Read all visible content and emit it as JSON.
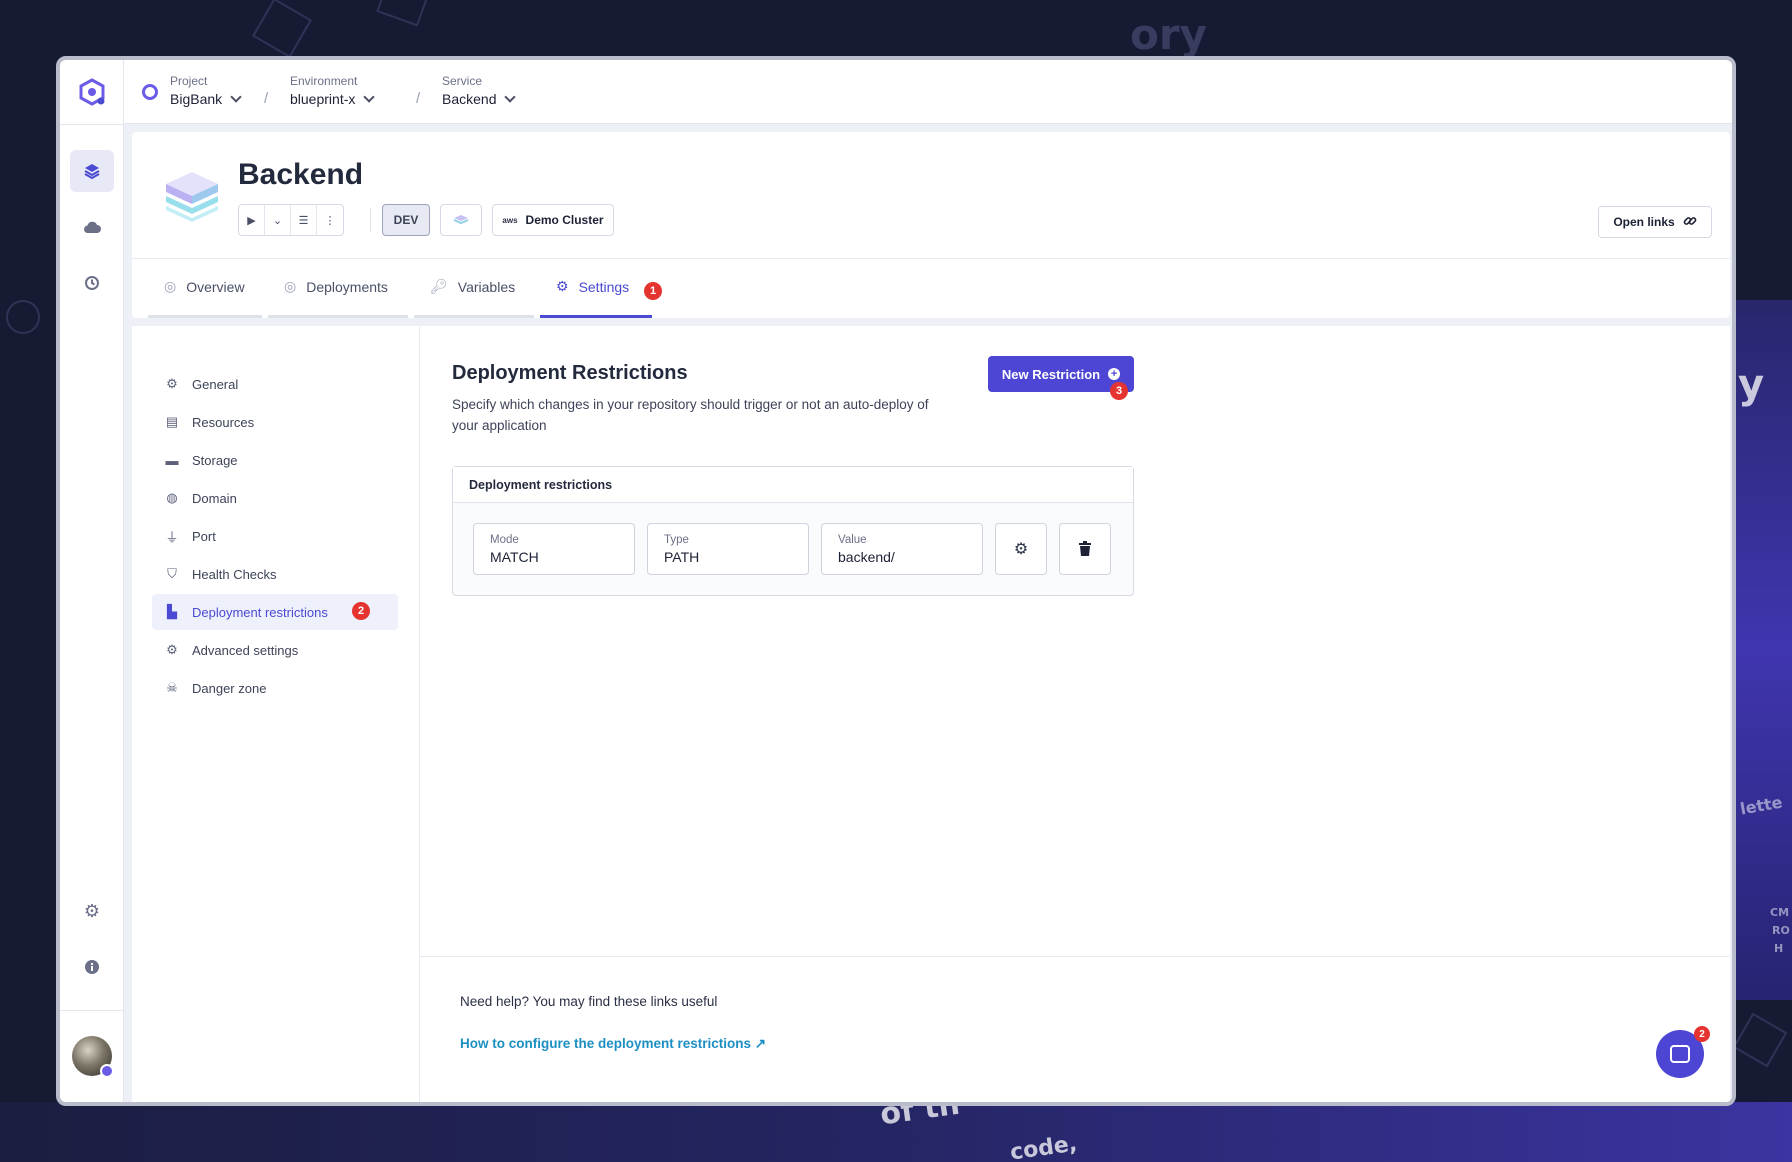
{
  "breadcrumbs": [
    {
      "label": "Project",
      "value": "BigBank"
    },
    {
      "label": "Environment",
      "value": "blueprint-x"
    },
    {
      "label": "Service",
      "value": "Backend"
    }
  ],
  "separator": "/",
  "service": {
    "title": "Backend",
    "env_tag": "DEV",
    "cluster_provider": "aws",
    "cluster": "Demo Cluster",
    "open_links": "Open links"
  },
  "tabs": [
    {
      "label": "Overview",
      "icon": "circle-icon"
    },
    {
      "label": "Deployments",
      "icon": "circle-icon"
    },
    {
      "label": "Variables",
      "icon": "key-icon"
    },
    {
      "label": "Settings",
      "icon": "gear-icon",
      "active": true
    }
  ],
  "badges": {
    "tab": "1",
    "subnav": "2",
    "button": "3",
    "chat": "2"
  },
  "settings_nav": [
    {
      "label": "General",
      "icon": "gear-icon"
    },
    {
      "label": "Resources",
      "icon": "resources-icon"
    },
    {
      "label": "Storage",
      "icon": "storage-icon"
    },
    {
      "label": "Domain",
      "icon": "globe-icon"
    },
    {
      "label": "Port",
      "icon": "plug-icon"
    },
    {
      "label": "Health Checks",
      "icon": "shield-icon"
    },
    {
      "label": "Deployment restrictions",
      "icon": "restriction-icon",
      "active": true
    },
    {
      "label": "Advanced settings",
      "icon": "gears-icon"
    },
    {
      "label": "Danger zone",
      "icon": "skull-icon"
    }
  ],
  "content": {
    "title": "Deployment Restrictions",
    "description": "Specify which changes in your repository should trigger or not an auto-deploy of your application",
    "new_button": "New Restriction",
    "box_title": "Deployment restrictions",
    "restriction": {
      "mode_label": "Mode",
      "mode_value": "MATCH",
      "type_label": "Type",
      "type_value": "PATH",
      "value_label": "Value",
      "value_value": "backend/"
    }
  },
  "help": {
    "text": "Need help? You may find these links useful",
    "link": "How to configure the deployment restrictions"
  },
  "background_words": [
    "ory",
    "y",
    "of th",
    "code,",
    "lette",
    "CM",
    "RO",
    "H"
  ],
  "colors": {
    "accent": "#4d45d4",
    "badge": "#e5342f",
    "link": "#1c8fc2"
  }
}
